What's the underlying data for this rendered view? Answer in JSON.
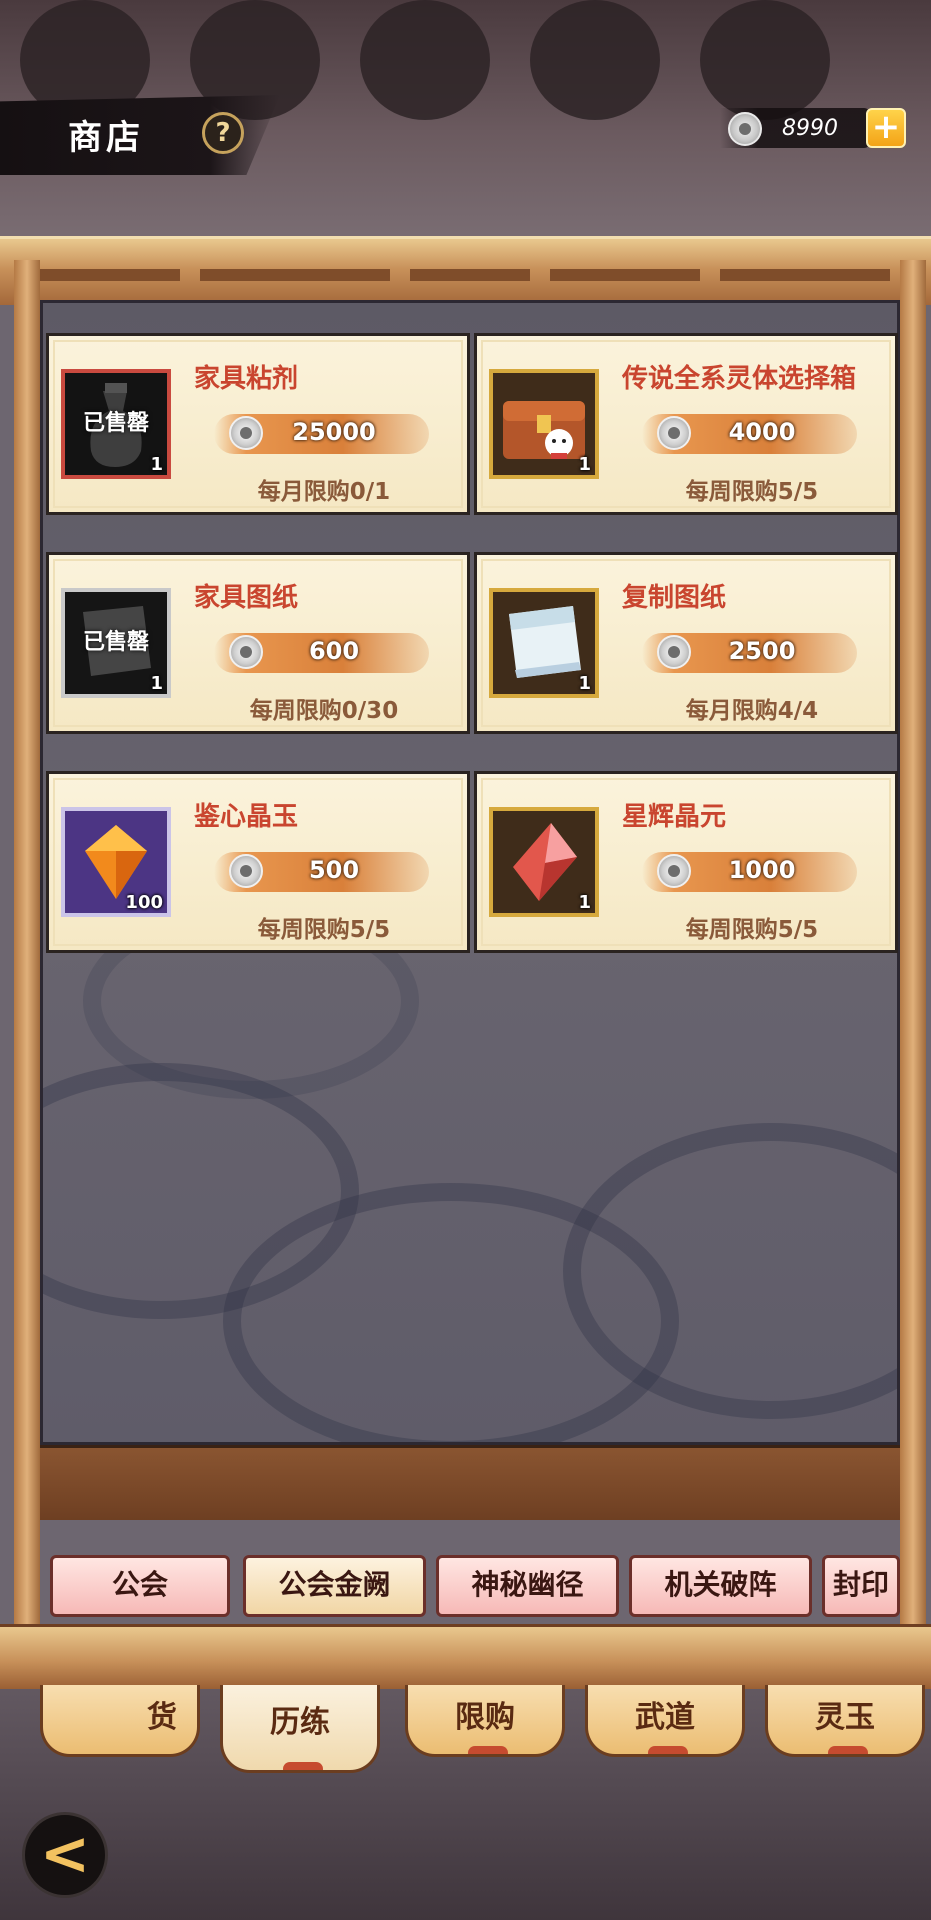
{
  "header": {
    "title": "商店",
    "help_icon": "?",
    "currency_amount": "8990",
    "add_icon": "+"
  },
  "items": [
    {
      "name": "家具粘剂",
      "price": "25000",
      "limit": "每月限购0/1",
      "qty": "1",
      "sold_out": true,
      "sold_label": "已售罄"
    },
    {
      "name": "传说全系灵体选择箱",
      "price": "4000",
      "limit": "每周限购5/5",
      "qty": "1",
      "sold_out": false
    },
    {
      "name": "家具图纸",
      "price": "600",
      "limit": "每周限购0/30",
      "qty": "1",
      "sold_out": true,
      "sold_label": "已售罄"
    },
    {
      "name": "复制图纸",
      "price": "2500",
      "limit": "每月限购4/4",
      "qty": "1",
      "sold_out": false
    },
    {
      "name": "鉴心晶玉",
      "price": "500",
      "limit": "每周限购5/5",
      "qty": "100",
      "sold_out": false
    },
    {
      "name": "星辉晶元",
      "price": "1000",
      "limit": "每周限购5/5",
      "qty": "1",
      "sold_out": false
    }
  ],
  "sub_tabs": [
    "公会",
    "公会金阙",
    "神秘幽径",
    "机关破阵",
    "封印"
  ],
  "main_tabs": [
    "货",
    "历练",
    "限购",
    "武道",
    "灵玉"
  ],
  "back_icon": "<"
}
